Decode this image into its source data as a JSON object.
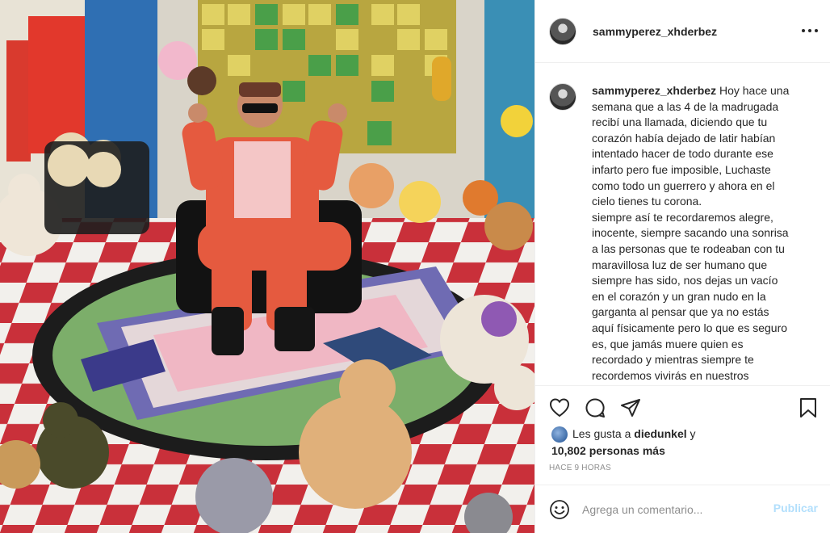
{
  "post": {
    "username": "sammyperez_xhderbez",
    "caption_lines": [
      "Hoy hace una",
      "semana que a las 4 de la madrugada",
      "recibí una llamada, diciendo que tu",
      "corazón había dejado de latir habían",
      "intentado hacer de todo durante ese",
      "infarto pero fue imposible, Luchaste",
      "como todo un guerrero y ahora en el",
      "cielo tienes tu corona.",
      "siempre así te recordaremos alegre,",
      "inocente, siempre sacando una sonrisa",
      "a las personas que te rodeaban con tu",
      "maravillosa luz de ser humano que",
      "siempre has sido, nos dejas un vacío",
      "en el corazón y un gran nudo en la",
      "garganta al pensar que ya no estás",
      "aquí físicamente pero lo que es seguro",
      "es, que jamás muere quien es",
      "recordado y mientras siempre te",
      "recordemos vivirás en nuestros"
    ],
    "likes_prefix": "Les gusta a",
    "liked_by": "diedunkel",
    "likes_connector": "y",
    "likes_count_text": "10,802 personas más",
    "timestamp": "HACE 9 HORAS"
  },
  "comment": {
    "placeholder": "Agrega un comentario...",
    "publish_label": "Publicar"
  },
  "colors": {
    "accent_disabled": "#b2dffc",
    "muted": "#8e8e8e",
    "border": "#efefef"
  },
  "icons": {
    "more": "more-horizontal-icon",
    "like": "heart-icon",
    "comment": "comment-icon",
    "share": "send-icon",
    "save": "bookmark-icon",
    "emoji": "emoji-icon"
  }
}
